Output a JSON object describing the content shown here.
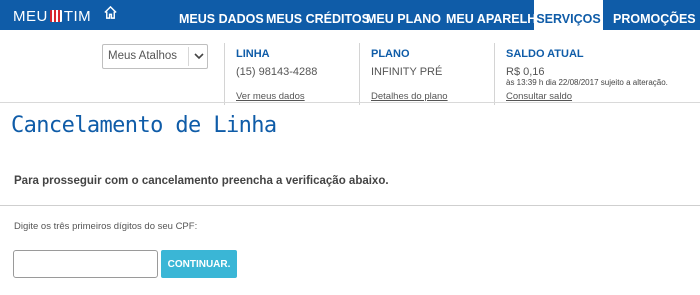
{
  "logo": {
    "left_text": "MEU",
    "right_text": "TIM"
  },
  "nav": {
    "items": [
      {
        "label": "MEUS DADOS"
      },
      {
        "label": "MEUS CRÉDITOS"
      },
      {
        "label": "MEU PLANO"
      },
      {
        "label": "MEU APARELHO"
      },
      {
        "label": "SERVIÇOS"
      },
      {
        "label": "PROMOÇÕES"
      }
    ],
    "active": "SERVIÇOS"
  },
  "shortcuts": {
    "selected": "Meus Atalhos"
  },
  "info": {
    "linha": {
      "header": "LINHA",
      "value": "(15) 98143-4288",
      "link": "Ver meus dados"
    },
    "plano": {
      "header": "PLANO",
      "value": "INFINITY PRÉ",
      "link": "Detalhes do plano"
    },
    "saldo": {
      "header": "SALDO ATUAL",
      "value": "R$ 0,16",
      "note": "às 13:39 h dia 22/08/2017 sujeito a alteração.",
      "link": "Consultar saldo"
    }
  },
  "page": {
    "title": "Cancelamento de Linha",
    "instruction": "Para prosseguir com o cancelamento preencha a verificação abaixo.",
    "cpf_label": "Digite os três primeiros dígitos do seu CPF:",
    "cpf_value": "",
    "continue_label": "CONTINUAR."
  },
  "colors": {
    "brand_blue": "#0f5ca8",
    "button_cyan": "#3ab6d6"
  }
}
